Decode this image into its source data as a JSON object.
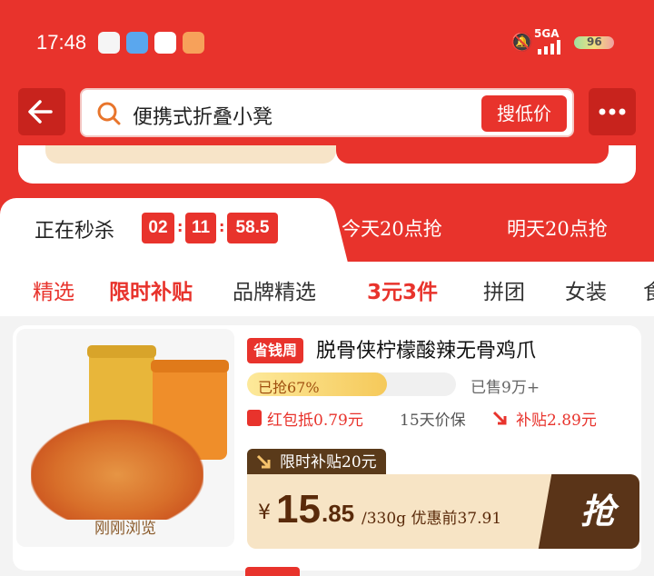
{
  "status": {
    "time": "17:48",
    "signal": "5GA",
    "battery": "96"
  },
  "search": {
    "query": "便携式折叠小凳",
    "button": "搜低价"
  },
  "flash_tabs": {
    "active_label": "正在秒杀",
    "countdown": [
      "02",
      "11",
      "58.5"
    ],
    "tab2": "今天20点抢",
    "tab3": "明天20点抢"
  },
  "categories": [
    {
      "label": "精选"
    },
    {
      "label": "限时补贴"
    },
    {
      "label": "品牌精选"
    },
    {
      "label": "3元3件"
    },
    {
      "label": "拼团"
    },
    {
      "label": "女装"
    },
    {
      "label": "食"
    }
  ],
  "product": {
    "badge": "省钱周",
    "title": "脱骨侠柠檬酸辣无骨鸡爪",
    "progress_label": "已抢67%",
    "progress": 0.67,
    "sold": "已售9万+",
    "perk_coupon": "红包抵0.79元",
    "perk_protect": "15天价保",
    "perk_subsidy": "补贴2.89元",
    "subsidy_tag": "限时补贴20元",
    "currency": "¥",
    "price_int": "15",
    "price_dec": ".85",
    "unit_note": "/330g 优惠前37.91",
    "grab": "抢",
    "recent": "刚刚浏览"
  },
  "colors": {
    "accent": "#e8332c",
    "brown": "#5a3418",
    "cream": "#f7e4c5"
  }
}
